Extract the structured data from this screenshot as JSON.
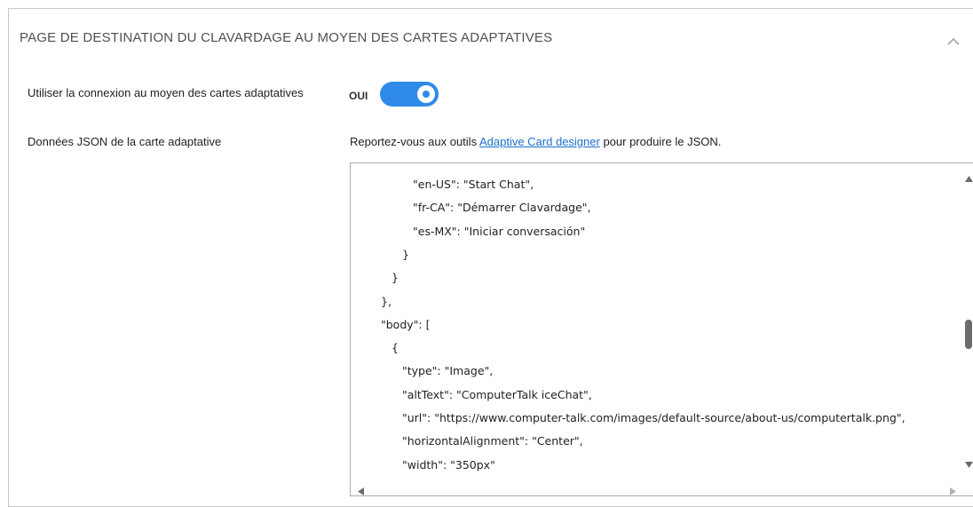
{
  "section": {
    "title": "PAGE DE DESTINATION DU CLAVARDAGE AU MOYEN DES CARTES ADAPTATIVES",
    "collapse_icon": "chevron-up-icon"
  },
  "adaptive_login": {
    "label": "Utiliser la connexion au moyen des cartes adaptatives",
    "toggle_state_label": "OUI",
    "toggle_on": true
  },
  "json_data": {
    "label": "Données JSON de la carte adaptative",
    "hint_prefix": "Reportez-vous aux outils ",
    "hint_link": "Adaptive Card designer",
    "hint_suffix": " pour produire le JSON."
  },
  "editor": {
    "lines": [
      "\"en-US\": \"Start Chat\",",
      "\"fr-CA\": \"Démarrer Clavardage\",",
      "\"es-MX\": \"Iniciar conversación\"",
      "}",
      "}",
      "},",
      "\"body\": [",
      "{",
      "\"type\": \"Image\",",
      "\"altText\": \"ComputerTalk iceChat\",",
      "\"url\": \"https://www.computer-talk.com/images/default-source/about-us/computertalk.png\",",
      "\"horizontalAlignment\": \"Center\",",
      "\"width\": \"350px\""
    ],
    "indents": [
      4,
      4,
      4,
      3,
      2,
      1,
      1,
      2,
      3,
      3,
      3,
      3,
      3
    ]
  },
  "colors": {
    "accent": "#2f8ae8",
    "link": "#1b6fcc",
    "border": "#c9c9c9"
  }
}
